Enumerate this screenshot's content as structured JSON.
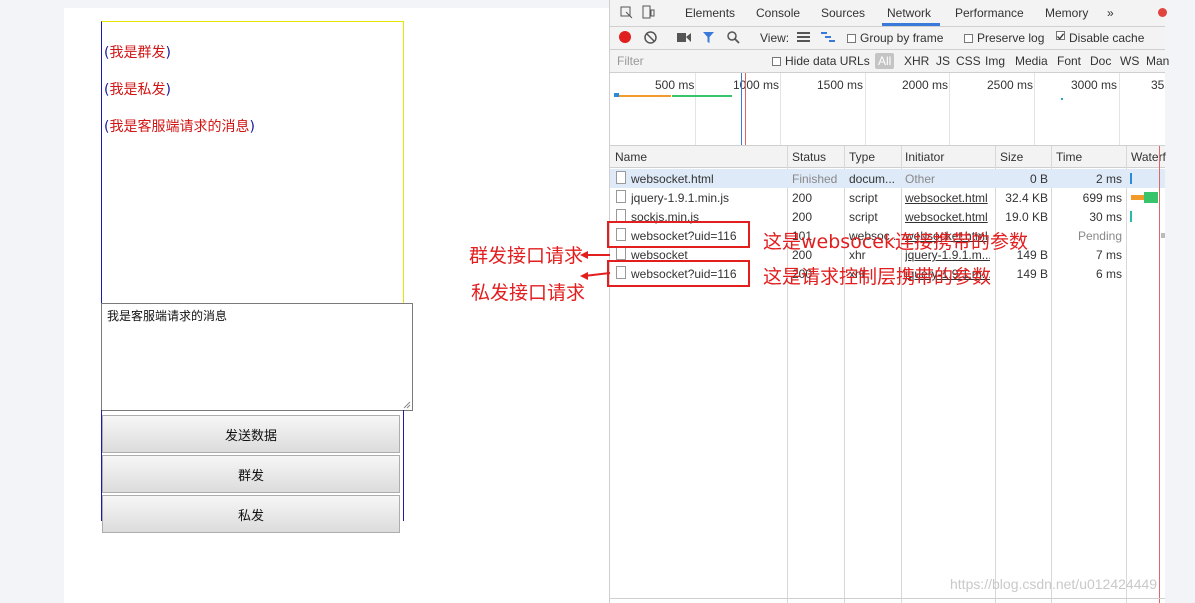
{
  "page": {
    "messages": [
      {
        "text": "我是群发"
      },
      {
        "text": "我是私发"
      },
      {
        "text": "我是客服端请求的消息"
      }
    ],
    "open_paren": "(",
    "close_paren": ")",
    "textarea_value": "我是客服端请求的消息",
    "buttons": {
      "send": "发送数据",
      "group": "群发",
      "private": "私发"
    }
  },
  "devtools": {
    "tabs": [
      "Elements",
      "Console",
      "Sources",
      "Network",
      "Performance",
      "Memory",
      "»"
    ],
    "active_tab": "Network",
    "toolbar": {
      "view_label": "View:",
      "group_by_frame": "Group by frame",
      "preserve_log": "Preserve log",
      "disable_cache": "Disable cache"
    },
    "filter": {
      "placeholder": "Filter",
      "hide_data_urls": "Hide data URLs",
      "types": [
        "All",
        "XHR",
        "JS",
        "CSS",
        "Img",
        "Media",
        "Font",
        "Doc",
        "WS",
        "Man"
      ]
    },
    "timeline_ticks": [
      "500 ms",
      "1000 ms",
      "1500 ms",
      "2000 ms",
      "2500 ms",
      "3000 ms",
      "35"
    ],
    "columns": [
      "Name",
      "Status",
      "Type",
      "Initiator",
      "Size",
      "Time",
      "Waterf"
    ],
    "rows": [
      {
        "name": "websocket.html",
        "status": "Finished",
        "type": "docum...",
        "initiator": "Other",
        "size": "0 B",
        "time": "2 ms"
      },
      {
        "name": "jquery-1.9.1.min.js",
        "status": "200",
        "type": "script",
        "initiator": "websocket.html",
        "size": "32.4 KB",
        "time": "699 ms"
      },
      {
        "name": "sockjs.min.js",
        "status": "200",
        "type": "script",
        "initiator": "websocket.html",
        "size": "19.0 KB",
        "time": "30 ms"
      },
      {
        "name": "websocket?uid=116",
        "status": "101",
        "type": "websoc...",
        "initiator": "websocket.html",
        "size": "",
        "time": "Pending"
      },
      {
        "name": "websocket",
        "status": "200",
        "type": "xhr",
        "initiator": "jquery-1.9.1.m...",
        "size": "149 B",
        "time": "7 ms"
      },
      {
        "name": "websocket?uid=116",
        "status": "200",
        "type": "xhr",
        "initiator": "jquery-1.9.1.m...",
        "size": "149 B",
        "time": "6 ms"
      }
    ]
  },
  "annotations": {
    "group_label": "群发接口请求",
    "private_label": "私发接口请求",
    "ws_note": "这是websocek连接携带的参数",
    "ctrl_note": "这是请求控制层携带的参数"
  },
  "watermark": "https://blog.csdn.net/u012424449",
  "colors": {
    "annotation": "#e21e1e",
    "accent": "#3879d9",
    "message_text": "#d21414"
  }
}
